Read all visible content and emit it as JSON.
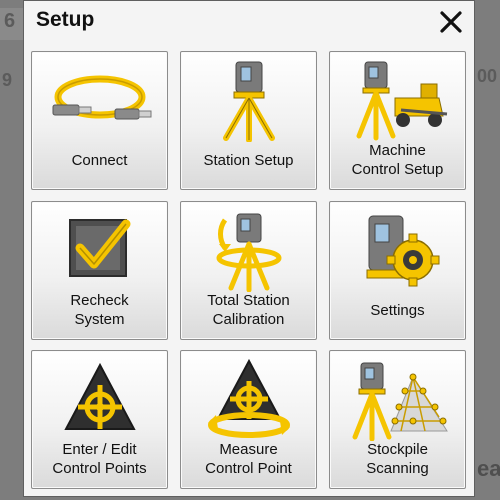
{
  "dialog": {
    "title": "Setup"
  },
  "background": {
    "left_digit": "6",
    "left_number": "9",
    "right_number": "00",
    "right_bottom": "ea"
  },
  "tiles": [
    {
      "label": "Connect",
      "icon": "usb-cable-icon"
    },
    {
      "label": "Station Setup",
      "icon": "total-station-tripod-icon"
    },
    {
      "label": "Machine\nControl Setup",
      "icon": "grader-total-station-icon"
    },
    {
      "label": "Recheck\nSystem",
      "icon": "checkbox-checkmark-icon"
    },
    {
      "label": "Total Station\nCalibration",
      "icon": "station-calibration-icon"
    },
    {
      "label": "Settings",
      "icon": "station-gear-icon"
    },
    {
      "label": "Enter / Edit\nControl Points",
      "icon": "control-point-icon"
    },
    {
      "label": "Measure\nControl Point",
      "icon": "measure-control-point-icon"
    },
    {
      "label": "Stockpile\nScanning",
      "icon": "stockpile-scan-icon"
    }
  ],
  "colors": {
    "accent": "#f5c400",
    "dialog_bg": "#f4f4f4",
    "overlay": "#7d7d7d"
  }
}
